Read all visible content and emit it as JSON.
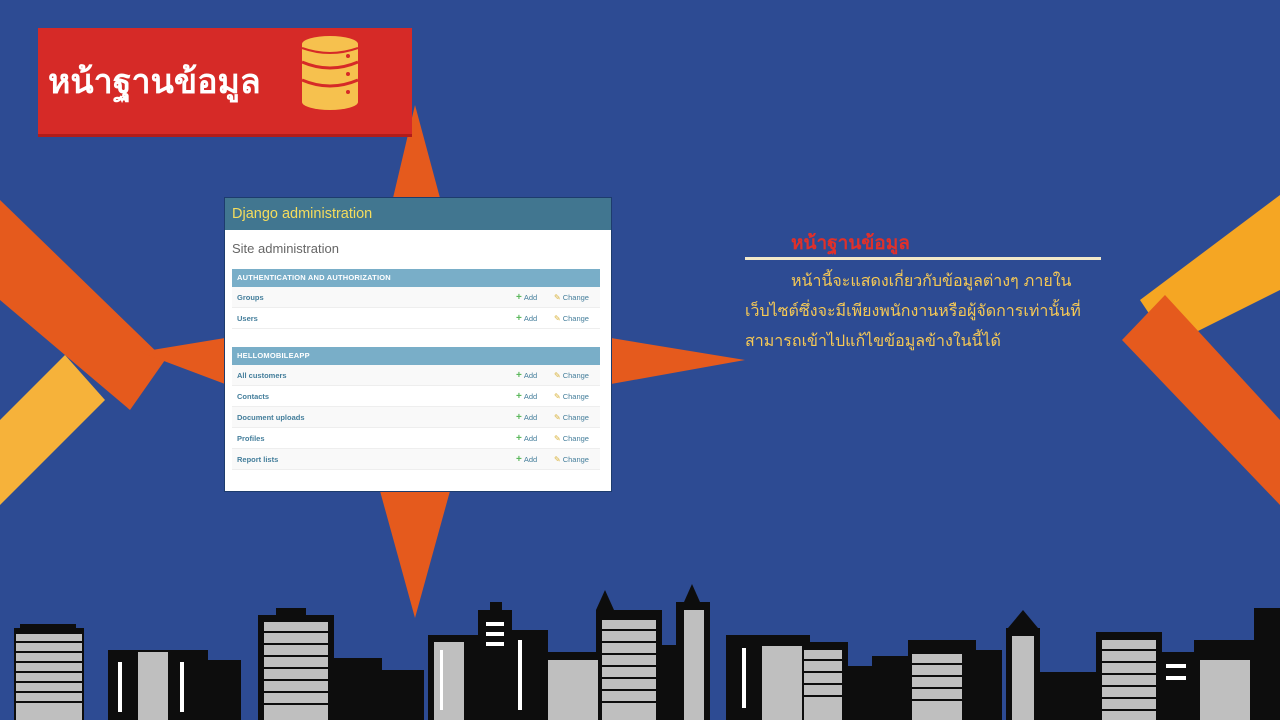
{
  "slide": {
    "title": "หน้าฐานข้อมูล",
    "title_icon": "database-icon",
    "colors": {
      "background": "#2d4b93",
      "title_box": "#d62a27",
      "accent_orange": "#e55a1d",
      "accent_yellow": "#f5a623"
    }
  },
  "admin": {
    "header": "Django administration",
    "page_title": "Site administration",
    "add_label": "Add",
    "change_label": "Change",
    "modules": [
      {
        "caption": "AUTHENTICATION AND AUTHORIZATION",
        "models": [
          "Groups",
          "Users"
        ]
      },
      {
        "caption": "HELLOMOBILEAPP",
        "models": [
          "All customers",
          "Contacts",
          "Document uploads",
          "Profiles",
          "Report lists"
        ]
      }
    ]
  },
  "description": {
    "heading": "หน้าฐานข้อมูล",
    "body": "หน้านี้จะแสดงเกี่ยวกับข้อมูลต่างๆ ภายในเว็บไซต์ซึ่งจะมีเพียงพนักงานหรือผู้จัดการเท่านั้นที่สามารถเข้าไปแก้ไขข้อมูลข้างในนี้ได้"
  }
}
